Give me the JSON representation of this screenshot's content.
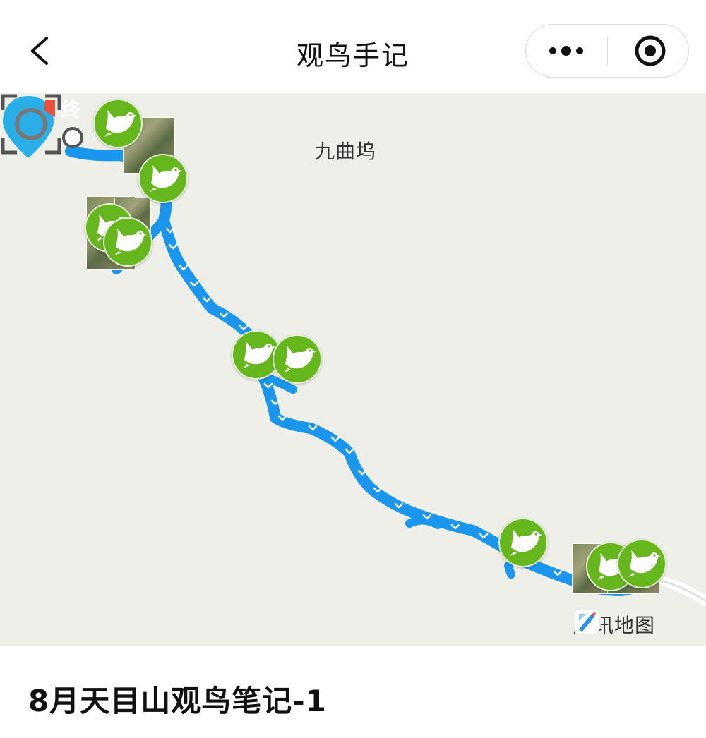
{
  "nav": {
    "title": "观鸟手记",
    "back_icon": "chevron-left-icon",
    "more_icon": "more-dots-icon",
    "close_icon": "target-close-icon"
  },
  "map": {
    "place_label": "九曲坞",
    "end_marker_label": "终",
    "brand_text": "腾讯地图",
    "route_color": "#1a96ee",
    "marker_color": "#66b71e",
    "locate_icon": "locate-icon"
  },
  "note": {
    "title": "8月天目山观鸟笔记-1"
  }
}
